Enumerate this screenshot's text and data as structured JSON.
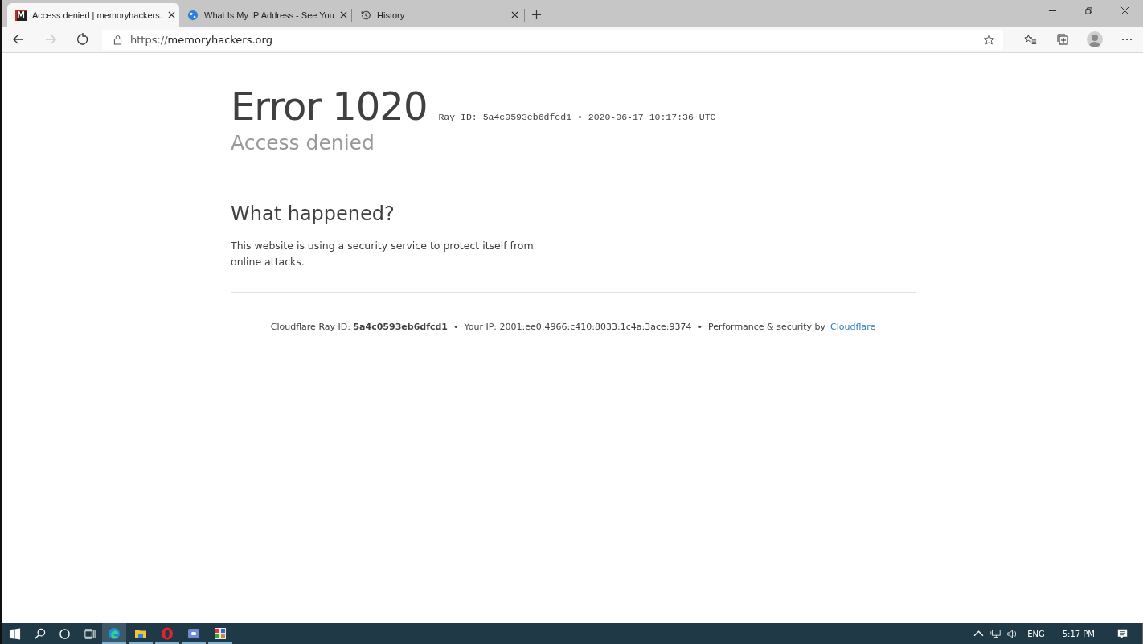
{
  "tabs": [
    {
      "title": "Access denied | memoryhackers.",
      "kind": "letter",
      "favicon_text": "M",
      "selected": true
    },
    {
      "title": "What Is My IP Address - See You",
      "kind": "globe",
      "selected": false
    },
    {
      "title": "History",
      "kind": "history",
      "selected": false
    }
  ],
  "address_bar": {
    "url_prefix": "https://",
    "url_host": "memoryhackers.org"
  },
  "page": {
    "error_title": "Error 1020",
    "ray_line": "Ray ID: 5a4c0593eb6dfcd1 • 2020-06-17 10:17:36 UTC",
    "subtitle": "Access denied",
    "section_heading": "What happened?",
    "section_text": "This website is using a security service to protect itself from online attacks.",
    "footer": [
      {
        "kind": "text",
        "text": "Cloudflare Ray ID: **5a4c0593eb6dfcd1**"
      },
      {
        "kind": "text",
        "text": "Your IP: 2001:ee0:4966:c410:8033:1c4a:3ace:9374"
      },
      {
        "kind": "text_link",
        "text": "Performance & security by",
        "link": "Cloudflare"
      }
    ],
    "separator": "•"
  },
  "taskbar": {
    "apps": [
      {
        "kind": "edge",
        "selected": true
      },
      {
        "kind": "folder",
        "selected": false
      },
      {
        "kind": "opera",
        "selected": false
      },
      {
        "kind": "discord",
        "selected": false
      },
      {
        "kind": "grid",
        "selected": false
      }
    ],
    "language": "ENG",
    "time": "5:17 PM"
  }
}
